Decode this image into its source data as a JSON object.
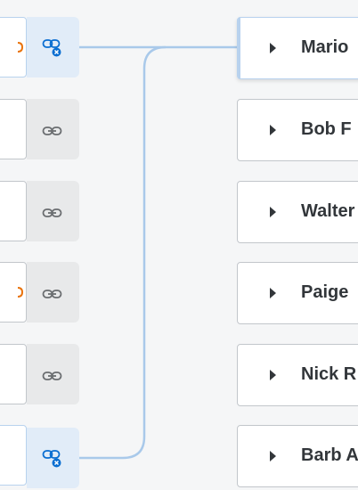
{
  "colors": {
    "link_line": "#a9c9ea",
    "link_icon_active": "#0a6ed1",
    "link_icon_inactive": "#6a6d70",
    "unlink_badge": "#0a6ed1",
    "accent_orange": "#e9730c"
  },
  "icons": {
    "link": "link-icon",
    "unlink": "unlink-icon",
    "expand": "caret-right-icon"
  },
  "left_items": [
    {
      "linked": true,
      "partial_icon": true
    },
    {
      "linked": false,
      "partial_icon": false
    },
    {
      "linked": false,
      "partial_icon": false
    },
    {
      "linked": false,
      "partial_icon": true
    },
    {
      "linked": false,
      "partial_icon": false
    },
    {
      "linked": true,
      "partial_icon": false
    }
  ],
  "right_items": [
    {
      "label": "Mario",
      "selected": true
    },
    {
      "label": "Bob F",
      "selected": false
    },
    {
      "label": "Walter",
      "selected": false
    },
    {
      "label": "Paige",
      "selected": false
    },
    {
      "label": "Nick R",
      "selected": false
    },
    {
      "label": "Barb A",
      "selected": false
    }
  ]
}
